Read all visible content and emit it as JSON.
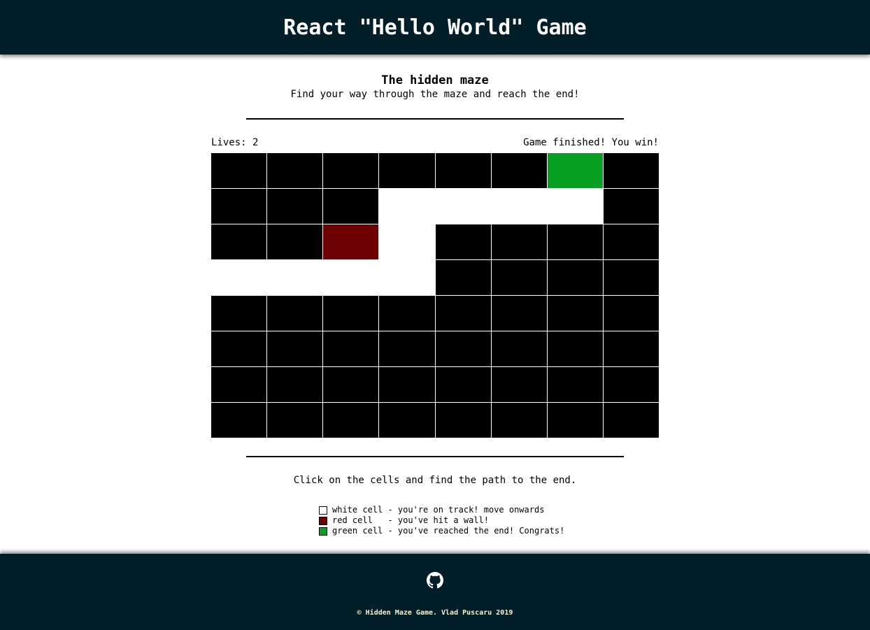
{
  "header": {
    "title": "React \"Hello World\" Game"
  },
  "intro": {
    "title": "The hidden maze",
    "subtitle": "Find your way through the maze and reach the end!"
  },
  "status": {
    "lives": "Lives: 2",
    "message": "Game finished! You win!"
  },
  "maze": {
    "rows": [
      [
        "black",
        "black",
        "black",
        "black",
        "black",
        "black",
        "green",
        "black"
      ],
      [
        "black",
        "black",
        "black",
        "white",
        "white",
        "white",
        "white",
        "black"
      ],
      [
        "black",
        "black",
        "red",
        "white",
        "black",
        "black",
        "black",
        "black"
      ],
      [
        "white",
        "white",
        "white",
        "white",
        "black",
        "black",
        "black",
        "black"
      ],
      [
        "black",
        "black",
        "black",
        "black",
        "black",
        "black",
        "black",
        "black"
      ],
      [
        "black",
        "black",
        "black",
        "black",
        "black",
        "black",
        "black",
        "black"
      ],
      [
        "black",
        "black",
        "black",
        "black",
        "black",
        "black",
        "black",
        "black"
      ],
      [
        "black",
        "black",
        "black",
        "black",
        "black",
        "black",
        "black",
        "black"
      ]
    ]
  },
  "instruction": "Click on the cells and find the path to the end.",
  "legend": [
    {
      "color": "#ffffff",
      "text": "white cell - you're on track! move onwards"
    },
    {
      "color": "#6d0000",
      "text": "red cell   - you've hit a wall!"
    },
    {
      "color": "#079f22",
      "text": "green cell - you've reached the end! Congrats!"
    }
  ],
  "footer": {
    "icon": "github-icon",
    "copyright": "© Hidden Maze Game. Vlad Puscaru 2019"
  }
}
